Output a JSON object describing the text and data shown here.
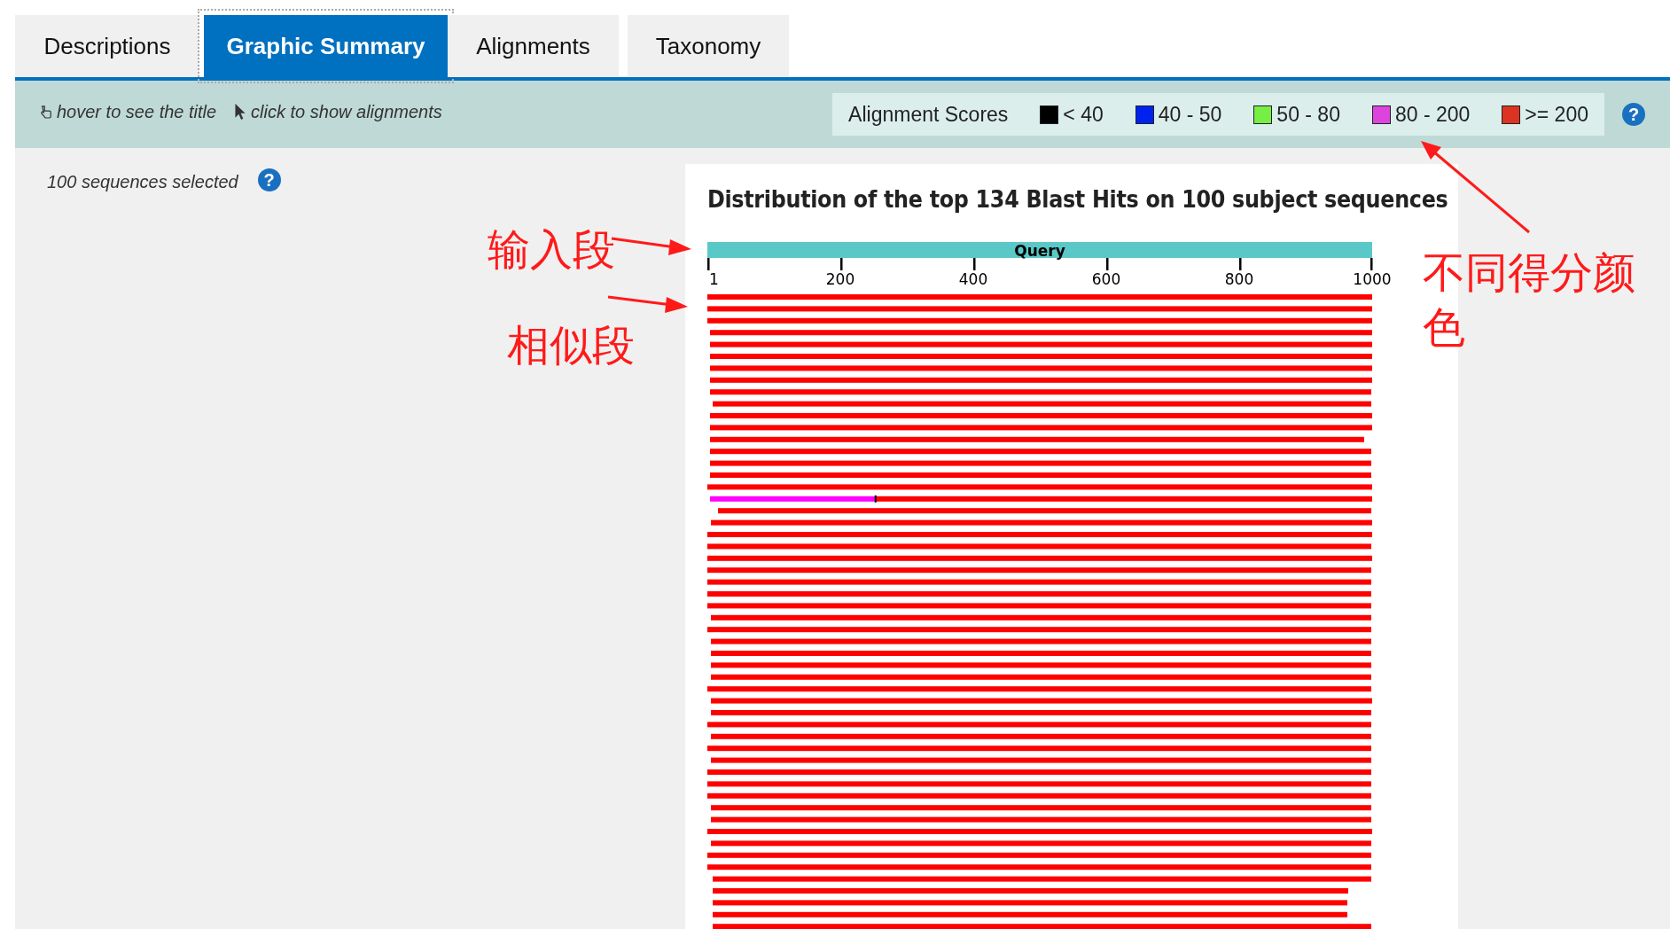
{
  "tabs": [
    {
      "label": "Descriptions",
      "selected": false
    },
    {
      "label": "Graphic Summary",
      "selected": true
    },
    {
      "label": "Alignments",
      "selected": false
    },
    {
      "label": "Taxonomy",
      "selected": false
    }
  ],
  "toolbar": {
    "hints": [
      {
        "kind": "hover",
        "text": "hover to see the title"
      },
      {
        "kind": "click",
        "text": "click to show alignments"
      }
    ],
    "legend": {
      "title": "Alignment Scores",
      "items": [
        {
          "label": "< 40",
          "color": "#000000"
        },
        {
          "label": "40 - 50",
          "color": "#0022ee"
        },
        {
          "label": "50 - 80",
          "color": "#77ee44"
        },
        {
          "label": "80 - 200",
          "color": "#dd44dd"
        },
        {
          "label": ">= 200",
          "color": "#dd3322"
        }
      ]
    },
    "help": "?"
  },
  "selection": {
    "text": "100 sequences selected",
    "help": "?"
  },
  "graphic": {
    "title": "Distribution of the top 134 Blast Hits on 100 subject sequences",
    "query_label": "Query",
    "ticks": [
      "1",
      "200",
      "400",
      "600",
      "800",
      "1000"
    ],
    "hits": [
      {
        "segments": [
          {
            "color": "#ff0000"
          }
        ]
      },
      {
        "segments": [
          {
            "color": "#ff0000"
          }
        ]
      },
      {
        "segments": [
          {
            "color": "#ff0000"
          }
        ]
      },
      {
        "segments": [
          {
            "color": "#ff0000"
          }
        ]
      },
      {
        "segments": [
          {
            "color": "#ff0000"
          }
        ]
      },
      {
        "segments": [
          {
            "color": "#ff0000"
          }
        ]
      },
      {
        "segments": [
          {
            "color": "#ff0000"
          }
        ]
      },
      {
        "segments": [
          {
            "color": "#ff0000"
          }
        ]
      },
      {
        "segments": [
          {
            "color": "#ff0000"
          }
        ]
      },
      {
        "segments": [
          {
            "color": "#ff0000"
          }
        ]
      },
      {
        "segments": [
          {
            "color": "#ff0000"
          }
        ]
      },
      {
        "segments": [
          {
            "color": "#ff0000"
          }
        ]
      },
      {
        "segments": [
          {
            "color": "#ff0000"
          }
        ]
      },
      {
        "segments": [
          {
            "color": "#ff0000"
          }
        ]
      },
      {
        "segments": [
          {
            "color": "#ff0000"
          }
        ]
      },
      {
        "segments": [
          {
            "color": "#ff0000"
          }
        ]
      },
      {
        "segments": [
          {
            "color": "#ff0000"
          }
        ]
      },
      {
        "segments": [
          {
            "color": "#ff00ff"
          },
          {
            "color": "#ff0000"
          }
        ]
      },
      {
        "segments": [
          {
            "color": "#ff0000"
          }
        ]
      },
      {
        "segments": [
          {
            "color": "#ff0000"
          }
        ]
      },
      {
        "segments": [
          {
            "color": "#ff0000"
          }
        ]
      },
      {
        "segments": [
          {
            "color": "#ff0000"
          }
        ]
      },
      {
        "segments": [
          {
            "color": "#ff0000"
          }
        ]
      },
      {
        "segments": [
          {
            "color": "#ff0000"
          }
        ]
      },
      {
        "segments": [
          {
            "color": "#ff0000"
          }
        ]
      },
      {
        "segments": [
          {
            "color": "#ff0000"
          }
        ]
      },
      {
        "segments": [
          {
            "color": "#ff0000"
          }
        ]
      },
      {
        "segments": [
          {
            "color": "#ff0000"
          }
        ]
      },
      {
        "segments": [
          {
            "color": "#ff0000"
          }
        ]
      },
      {
        "segments": [
          {
            "color": "#ff0000"
          }
        ]
      },
      {
        "segments": [
          {
            "color": "#ff0000"
          }
        ]
      },
      {
        "segments": [
          {
            "color": "#ff0000"
          }
        ]
      },
      {
        "segments": [
          {
            "color": "#ff0000"
          }
        ]
      },
      {
        "segments": [
          {
            "color": "#ff0000"
          }
        ]
      },
      {
        "segments": [
          {
            "color": "#ff0000"
          }
        ]
      },
      {
        "segments": [
          {
            "color": "#ff0000"
          }
        ]
      },
      {
        "segments": [
          {
            "color": "#ff0000"
          }
        ]
      },
      {
        "segments": [
          {
            "color": "#ff0000"
          }
        ]
      },
      {
        "segments": [
          {
            "color": "#ff0000"
          }
        ]
      },
      {
        "segments": [
          {
            "color": "#ff0000"
          }
        ]
      },
      {
        "segments": [
          {
            "color": "#ff0000"
          }
        ]
      },
      {
        "segments": [
          {
            "color": "#ff0000"
          }
        ]
      },
      {
        "segments": [
          {
            "color": "#ff0000"
          }
        ]
      },
      {
        "segments": [
          {
            "color": "#ff0000"
          }
        ]
      },
      {
        "segments": [
          {
            "color": "#ff0000"
          }
        ]
      },
      {
        "segments": [
          {
            "color": "#ff0000"
          }
        ]
      },
      {
        "segments": [
          {
            "color": "#ff0000"
          }
        ]
      },
      {
        "segments": [
          {
            "color": "#ff0000"
          }
        ]
      },
      {
        "segments": [
          {
            "color": "#ff0000"
          }
        ]
      },
      {
        "segments": [
          {
            "color": "#ff0000"
          }
        ]
      },
      {
        "segments": [
          {
            "color": "#ff0000"
          }
        ]
      },
      {
        "segments": [
          {
            "color": "#ff0000"
          }
        ]
      },
      {
        "segments": [
          {
            "color": "#ff0000"
          }
        ]
      },
      {
        "segments": [
          {
            "color": "#ff0000"
          }
        ]
      }
    ]
  },
  "annotations": [
    {
      "kind": "input",
      "text": "输入段"
    },
    {
      "kind": "similar",
      "text": "相似段"
    },
    {
      "kind": "colors",
      "text": "不同得分颜色"
    }
  ]
}
